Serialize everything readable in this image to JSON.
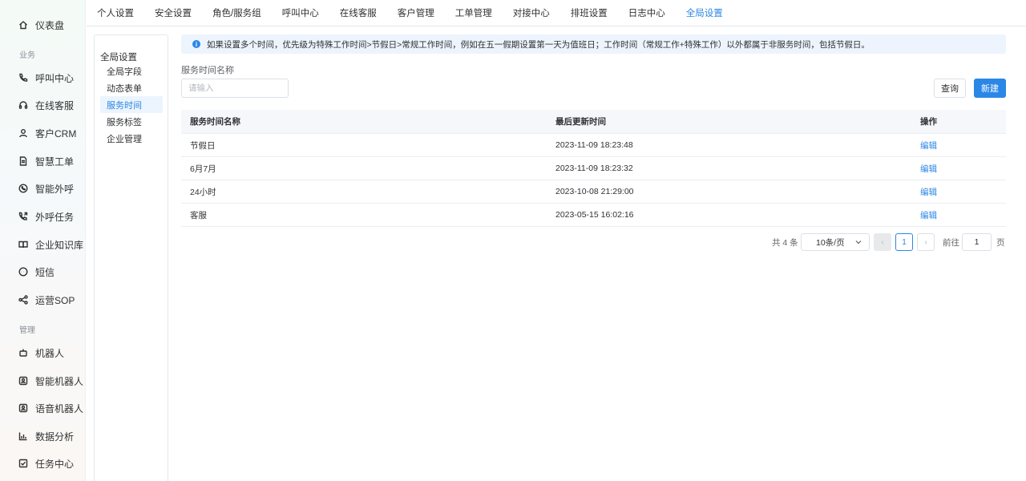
{
  "sidebar": {
    "items": [
      {
        "label": "仪表盘",
        "icon": "home-icon"
      },
      {
        "label": "呼叫中心",
        "icon": "phone-icon"
      },
      {
        "label": "在线客服",
        "icon": "headset-icon"
      },
      {
        "label": "客户CRM",
        "icon": "user-icon"
      },
      {
        "label": "智慧工单",
        "icon": "document-icon"
      },
      {
        "label": "智能外呼",
        "icon": "chat-phone-icon"
      },
      {
        "label": "外呼任务",
        "icon": "phone-forward-icon"
      },
      {
        "label": "企业知识库",
        "icon": "book-icon"
      },
      {
        "label": "短信",
        "icon": "message-icon"
      },
      {
        "label": "运营SOP",
        "icon": "share-icon"
      },
      {
        "label": "机器人",
        "icon": "robot-icon"
      },
      {
        "label": "智能机器人",
        "icon": "smart-robot-icon"
      },
      {
        "label": "语音机器人",
        "icon": "voice-robot-icon"
      },
      {
        "label": "数据分析",
        "icon": "chart-icon"
      },
      {
        "label": "任务中心",
        "icon": "task-icon"
      }
    ],
    "groups": {
      "business": "业务",
      "management": "管理"
    }
  },
  "topnav": {
    "tabs": [
      "个人设置",
      "安全设置",
      "角色/服务组",
      "呼叫中心",
      "在线客服",
      "客户管理",
      "工单管理",
      "对接中心",
      "排班设置",
      "日志中心",
      "全局设置"
    ],
    "active": "全局设置"
  },
  "submenu": {
    "title": "全局设置",
    "items": [
      "全局字段",
      "动态表单",
      "服务时间",
      "服务标签",
      "企业管理"
    ],
    "active": "服务时间"
  },
  "notice": "如果设置多个时间，优先级为特殊工作时间>节假日>常规工作时间，例如在五一假期设置第一天为值班日；工作时间（常规工作+特殊工作）以外都属于非服务时间，包括节假日。",
  "filter": {
    "label": "服务时间名称",
    "placeholder": "请输入",
    "query_label": "查询",
    "new_label": "新建"
  },
  "table": {
    "headers": [
      "服务时间名称",
      "最后更新时间",
      "操作"
    ],
    "rows": [
      {
        "name": "节假日",
        "updated": "2023-11-09 18:23:48",
        "action": "编辑"
      },
      {
        "name": "6月7月",
        "updated": "2023-11-09 18:23:32",
        "action": "编辑"
      },
      {
        "name": "24小时",
        "updated": "2023-10-08 21:29:00",
        "action": "编辑"
      },
      {
        "name": "客服",
        "updated": "2023-05-15 16:02:16",
        "action": "编辑"
      }
    ]
  },
  "pagination": {
    "total": "共 4 条",
    "page_size": "10条/页",
    "prev": "‹",
    "current": "1",
    "next": "›",
    "goto_label": "前往",
    "goto_value": "1",
    "page_unit": "页"
  },
  "colors": {
    "accent": "#2b87e6"
  }
}
